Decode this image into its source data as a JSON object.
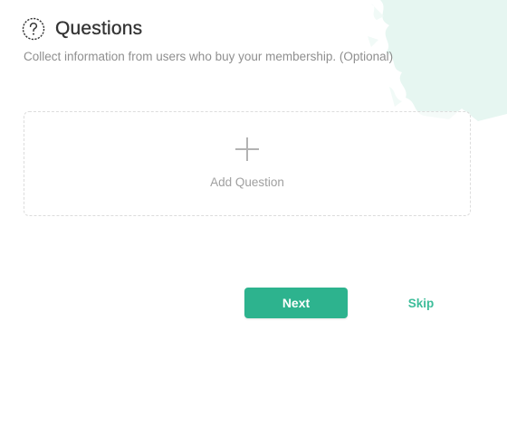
{
  "header": {
    "icon": "question-circle-icon",
    "title": "Questions"
  },
  "subtitle": "Collect information from users who buy your membership. (Optional)",
  "add_question": {
    "icon": "plus-icon",
    "label": "Add Question"
  },
  "actions": {
    "next_label": "Next",
    "skip_label": "Skip"
  },
  "colors": {
    "accent": "#2db38e",
    "skip_text": "#3dbd9a",
    "splash": "#e3f5f0"
  }
}
